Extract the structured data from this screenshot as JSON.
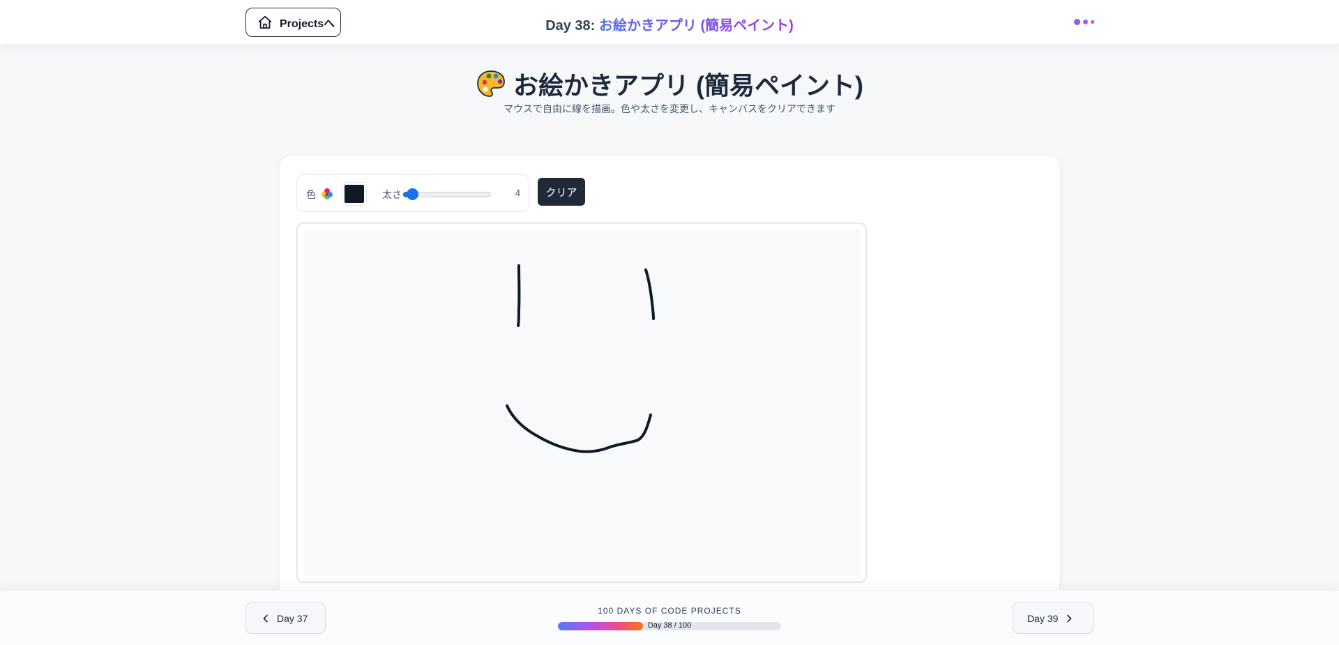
{
  "header": {
    "home_label": "Projectsへ",
    "title_day": "Day 38: ",
    "title_name": "お絵かきアプリ (簡易ペイント)"
  },
  "page": {
    "heading": "お絵かきアプリ (簡易ペイント)",
    "subtitle": "マウスで自由に線を描画。色や太さを変更し、キャンバスをクリアできます"
  },
  "toolbar": {
    "color_label": "色",
    "current_color": "#111827",
    "size_label": "太さ",
    "size_value": "4",
    "size_min": 1,
    "size_max": 30,
    "clear_label": "クリア"
  },
  "footer": {
    "prev_label": "Day 37",
    "next_label": "Day 39",
    "title": "100 DAYS OF CODE PROJECTS",
    "progress_text": "Day 38 / 100",
    "progress_fraction": 0.38
  },
  "colors": {
    "accent_blue": "#1a73e8",
    "dark": "#1f2937",
    "title_gradient_start": "#4f6ef0",
    "title_gradient_end": "#9b3ae6"
  },
  "icons": {
    "home": "home-icon",
    "palette": "palette-emoji-icon",
    "rainbow": "color-picker-icon",
    "prev": "chevron-left-icon",
    "next": "chevron-right-icon"
  }
}
